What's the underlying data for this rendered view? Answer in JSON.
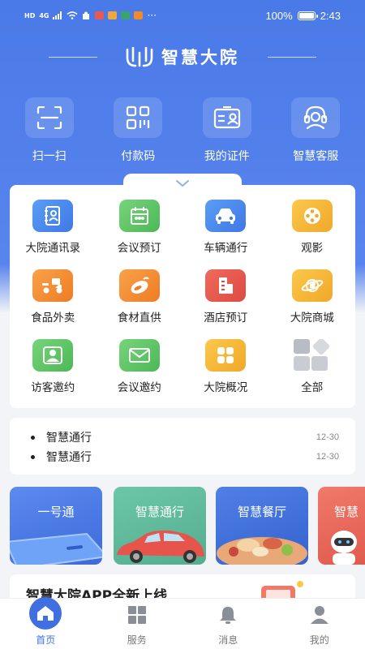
{
  "status_bar": {
    "left_badge_hd": "HD",
    "left_badge_signal": "4G",
    "battery_text": "100%",
    "time": "2:43",
    "more_dots": "···"
  },
  "header": {
    "title": "智慧大院"
  },
  "quick_actions": [
    {
      "label": "扫一扫",
      "icon": "scan-icon"
    },
    {
      "label": "付款码",
      "icon": "qr-code-icon"
    },
    {
      "label": "我的证件",
      "icon": "id-card-icon"
    },
    {
      "label": "智慧客服",
      "icon": "customer-service-icon"
    }
  ],
  "services": [
    {
      "label": "大院通讯录",
      "icon": "address-book-icon",
      "color": "#4f8ef0"
    },
    {
      "label": "会议预订",
      "icon": "calendar-icon",
      "color": "#5cc562"
    },
    {
      "label": "车辆通行",
      "icon": "car-icon",
      "color": "#4f8ef0"
    },
    {
      "label": "观影",
      "icon": "film-reel-icon",
      "color": "#f5b83a"
    },
    {
      "label": "食品外卖",
      "icon": "delivery-scooter-icon",
      "color": "#f08a2a"
    },
    {
      "label": "食材直供",
      "icon": "vegetables-icon",
      "color": "#f08a2a"
    },
    {
      "label": "酒店预订",
      "icon": "hotel-icon",
      "color": "#e8574e"
    },
    {
      "label": "大院商城",
      "icon": "shopping-planet-icon",
      "color": "#f5b83a"
    },
    {
      "label": "访客邀约",
      "icon": "visitor-icon",
      "color": "#5cc562"
    },
    {
      "label": "会议邀约",
      "icon": "mail-icon",
      "color": "#5cc562"
    },
    {
      "label": "大院概况",
      "icon": "overview-icon",
      "color": "#f5b83a"
    },
    {
      "label": "全部",
      "icon": "all-apps-icon",
      "color": "#c9ccd3"
    }
  ],
  "notices": [
    {
      "text": "智慧通行",
      "date": "12-30"
    },
    {
      "text": "智慧通行",
      "date": "12-30"
    }
  ],
  "banners": [
    {
      "label": "一号通",
      "color": "#4f7fe8"
    },
    {
      "label": "智慧通行",
      "color": "#5fb89b"
    },
    {
      "label": "智慧餐厅",
      "color": "#3d6fd8"
    },
    {
      "label": "智慧",
      "color": "#e8574e"
    }
  ],
  "news": {
    "text": "智慧大院APP全新上线"
  },
  "tab_bar": [
    {
      "label": "首页",
      "icon": "home-icon",
      "active": true
    },
    {
      "label": "服务",
      "icon": "grid-icon",
      "active": false
    },
    {
      "label": "消息",
      "icon": "bell-icon",
      "active": false
    },
    {
      "label": "我的",
      "icon": "person-icon",
      "active": false
    }
  ],
  "colors": {
    "primary": "#4a7ae8",
    "tab_active": "#3f6fe0"
  }
}
